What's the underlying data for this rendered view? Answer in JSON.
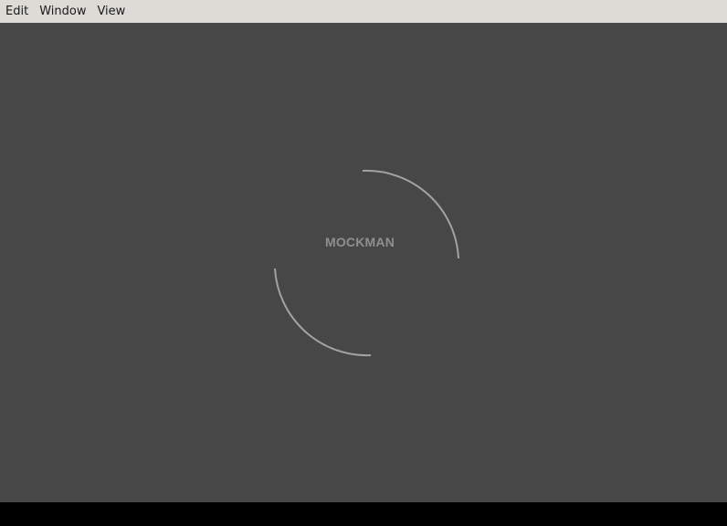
{
  "menubar": {
    "items": [
      {
        "label": "Edit"
      },
      {
        "label": "Window"
      },
      {
        "label": "View"
      }
    ]
  },
  "loading": {
    "label": "MOCKMAN"
  },
  "colors": {
    "menubar_bg": "#dddbd6",
    "content_bg": "#474747",
    "spinner_stroke": "#a3a3a3",
    "label_color": "#8f8f8f"
  },
  "icons": {
    "spinner": "loading-spinner-icon"
  }
}
